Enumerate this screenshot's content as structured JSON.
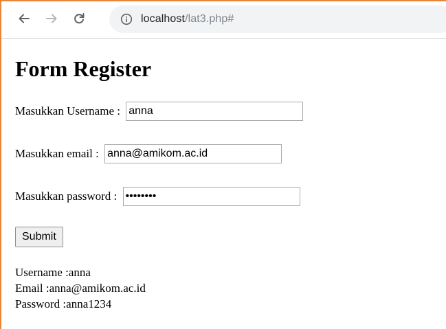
{
  "browser": {
    "url_host": "localhost",
    "url_path": "/lat3.php#"
  },
  "page": {
    "title": "Form Register"
  },
  "form": {
    "username_label": "Masukkan Username : ",
    "username_value": "anna",
    "email_label": "Masukkan email : ",
    "email_value": "anna@amikom.ac.id",
    "password_label": "Masukkan password : ",
    "password_value": "anna1234",
    "submit_label": "Submit"
  },
  "result": {
    "username_line": "Username :anna",
    "email_line": "Email :anna@amikom.ac.id",
    "password_line": "Password :anna1234"
  },
  "colors": {
    "window_border": "#e8873a",
    "omnibox_bg": "#f1f3f4"
  }
}
